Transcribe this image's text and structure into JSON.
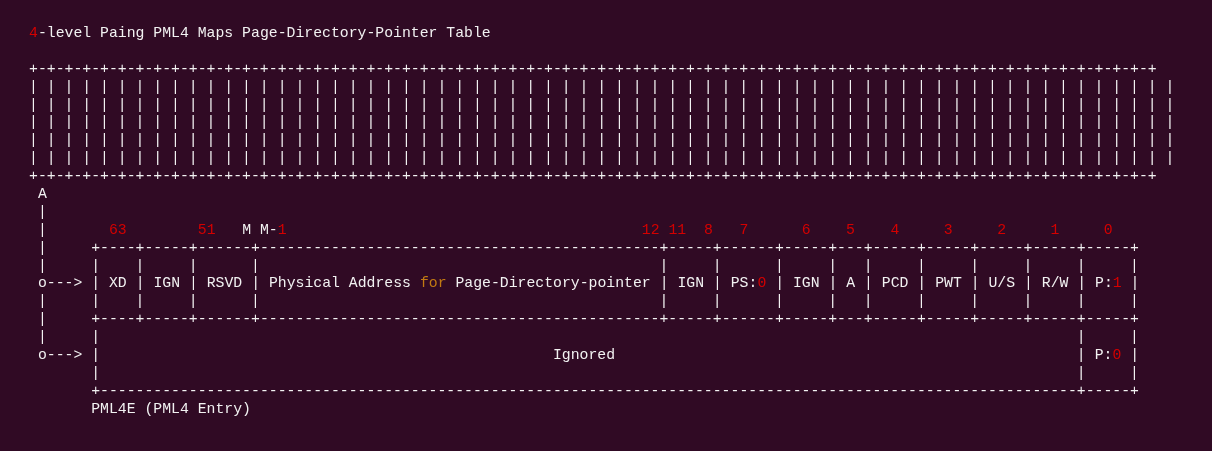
{
  "lines": [
    {
      "segments": [
        {
          "kind": "title",
          "parts": [
            {
              "text": "4",
              "kind": "number"
            },
            {
              "text": "-level Paing PML4 Maps Page-Directory-Pointer Table",
              "kind": "plain"
            }
          ]
        }
      ]
    },
    {
      "segments": [
        {
          "kind": "frame",
          "text": "+-+-+-+-+-+-+-+-+-+-+-+-+-+-+-+-+-+-+-+-+-+-+-+-+-+-+-+-+-+-+-+-+-+-+-+-+-+-+-+-+-+-+-+-+-+-+-+-+-+-+-+-+-+-+-+-+-+-+-+-+-+-+-+"
        }
      ]
    },
    {
      "segments": [
        {
          "kind": "frame",
          "text": "| | | | | | | | | | | | | | | | | | | | | | | | | | | | | | | | | | | | | | | | | | | | | | | | | | | | | | | | | | | | | | | | |"
        }
      ]
    },
    {
      "segments": [
        {
          "kind": "frame",
          "text": "| | | | | | | | | | | | | | | | | | | | | | | | | | | | | | | | | | | | | | | | | | | | | | | | | | | | | | | | | | | | | | | | |"
        }
      ]
    },
    {
      "segments": [
        {
          "kind": "frame",
          "text": "| | | | | | | | | | | | | | | | | | | | | | | | | | | | | | | | | | | | | | | | | | | | | | | | | | | | | | | | | | | | | | | | |"
        }
      ]
    },
    {
      "segments": [
        {
          "kind": "frame",
          "text": "| | | | | | | | | | | | | | | | | | | | | | | | | | | | | | | | | | | | | | | | | | | | | | | | | | | | | | | | | | | | | | | | |"
        }
      ]
    },
    {
      "segments": [
        {
          "kind": "frame",
          "text": "| | | | | | | | | | | | | | | | | | | | | | | | | | | | | | | | | | | | | | | | | | | | | | | | | | | | | | | | | | | | | | | | |"
        }
      ]
    },
    {
      "segments": [
        {
          "kind": "frame",
          "text": "+-+-+-+-+-+-+-+-+-+-+-+-+-+-+-+-+-+-+-+-+-+-+-+-+-+-+-+-+-+-+-+-+-+-+-+-+-+-+-+-+-+-+-+-+-+-+-+-+-+-+-+-+-+-+-+-+-+-+-+-+-+-+-+"
        }
      ]
    },
    {
      "segments": [
        {
          "kind": "arrow",
          "text": " A"
        }
      ]
    },
    {
      "segments": [
        {
          "kind": "arrow",
          "text": " |"
        }
      ]
    },
    {
      "segments": [
        {
          "kind": "arrow",
          "text": " |"
        },
        {
          "kind": "number",
          "text": "       63"
        },
        {
          "kind": "number",
          "text": "        51"
        },
        {
          "kind": "number",
          "parts": [
            {
              "text": "   M",
              "kind": "plain"
            }
          ]
        },
        {
          "kind": "number",
          "parts": [
            {
              "text": " M-",
              "kind": "plain"
            },
            {
              "text": "1",
              "kind": "number"
            }
          ]
        },
        {
          "kind": "number",
          "text": "                                        12"
        },
        {
          "kind": "number",
          "text": " 11"
        },
        {
          "kind": "number",
          "text": "  8"
        },
        {
          "kind": "number",
          "text": "   7"
        },
        {
          "kind": "number",
          "text": "      6"
        },
        {
          "kind": "number",
          "text": "    5"
        },
        {
          "kind": "number",
          "text": "    4"
        },
        {
          "kind": "number",
          "text": "     3"
        },
        {
          "kind": "number",
          "text": "     2"
        },
        {
          "kind": "number",
          "text": "     1"
        },
        {
          "kind": "number",
          "text": "     0"
        }
      ]
    },
    {
      "segments": [
        {
          "kind": "arrow",
          "text": " |"
        },
        {
          "kind": "frame",
          "text": "     +----+-----+------+---------------------------------------------+-----+------+-----+---+-----+-----+-----+-----+-----+"
        }
      ]
    },
    {
      "segments": [
        {
          "kind": "arrow",
          "text": " |"
        },
        {
          "kind": "frame",
          "text": "     |    |     |      |                                             |     |      |     |   |     |     |     |     |     |"
        }
      ]
    },
    {
      "segments": [
        {
          "kind": "arrow",
          "text": " o--->"
        },
        {
          "kind": "frame",
          "text": " |"
        },
        {
          "kind": "label",
          "text": " XD"
        },
        {
          "kind": "frame",
          "text": " |"
        },
        {
          "kind": "label",
          "text": " IGN"
        },
        {
          "kind": "frame",
          "text": " |"
        },
        {
          "kind": "label",
          "text": " RSVD"
        },
        {
          "kind": "frame",
          "text": " |"
        },
        {
          "kind": "label",
          "parts": [
            {
              "text": " Physical Address ",
              "kind": "plain"
            },
            {
              "text": "for",
              "kind": "keyword"
            },
            {
              "text": " Page-Directory-pointer",
              "kind": "plain"
            }
          ]
        },
        {
          "kind": "frame",
          "text": " |"
        },
        {
          "kind": "label",
          "text": " IGN"
        },
        {
          "kind": "frame",
          "text": " |"
        },
        {
          "kind": "label",
          "parts": [
            {
              "text": " PS:",
              "kind": "plain"
            },
            {
              "text": "0",
              "kind": "number"
            }
          ]
        },
        {
          "kind": "frame",
          "text": " |"
        },
        {
          "kind": "label",
          "text": " IGN"
        },
        {
          "kind": "frame",
          "text": " |"
        },
        {
          "kind": "label",
          "text": " A"
        },
        {
          "kind": "frame",
          "text": " |"
        },
        {
          "kind": "label",
          "text": " PCD"
        },
        {
          "kind": "frame",
          "text": " |"
        },
        {
          "kind": "label",
          "text": " PWT"
        },
        {
          "kind": "frame",
          "text": " |"
        },
        {
          "kind": "label",
          "text": " U/S"
        },
        {
          "kind": "frame",
          "text": " |"
        },
        {
          "kind": "label",
          "text": " R/W"
        },
        {
          "kind": "frame",
          "text": " |"
        },
        {
          "kind": "label",
          "parts": [
            {
              "text": " P:",
              "kind": "plain"
            },
            {
              "text": "1",
              "kind": "number"
            }
          ]
        },
        {
          "kind": "frame",
          "text": " |"
        }
      ]
    },
    {
      "segments": [
        {
          "kind": "arrow",
          "text": " |"
        },
        {
          "kind": "frame",
          "text": "     |    |     |      |                                             |     |      |     |   |     |     |     |     |     |"
        }
      ]
    },
    {
      "segments": [
        {
          "kind": "arrow",
          "text": " |"
        },
        {
          "kind": "frame",
          "text": "     +----+-----+------+---------------------------------------------+-----+------+-----+---+-----+-----+-----+-----+-----+"
        }
      ]
    },
    {
      "segments": [
        {
          "kind": "arrow",
          "text": " |"
        },
        {
          "kind": "frame",
          "text": "     |                                                                                                              |     |"
        }
      ]
    },
    {
      "segments": [
        {
          "kind": "arrow",
          "text": " o--->"
        },
        {
          "kind": "frame",
          "text": " |"
        },
        {
          "kind": "label",
          "text": "                                                   Ignored"
        },
        {
          "kind": "frame",
          "text": "                                                    |"
        },
        {
          "kind": "label",
          "parts": [
            {
              "text": " P:",
              "kind": "plain"
            },
            {
              "text": "0",
              "kind": "number"
            }
          ]
        },
        {
          "kind": "frame",
          "text": " |"
        }
      ]
    },
    {
      "segments": [
        {
          "kind": "frame",
          "text": "       |                                                                                                              |     |"
        }
      ]
    },
    {
      "segments": [
        {
          "kind": "frame",
          "text": "       +--------------------------------------------------------------------------------------------------------------+-----+"
        }
      ]
    },
    {
      "segments": [
        {
          "kind": "caption",
          "text": "       PML4E (PML4 Entry)"
        }
      ]
    }
  ]
}
